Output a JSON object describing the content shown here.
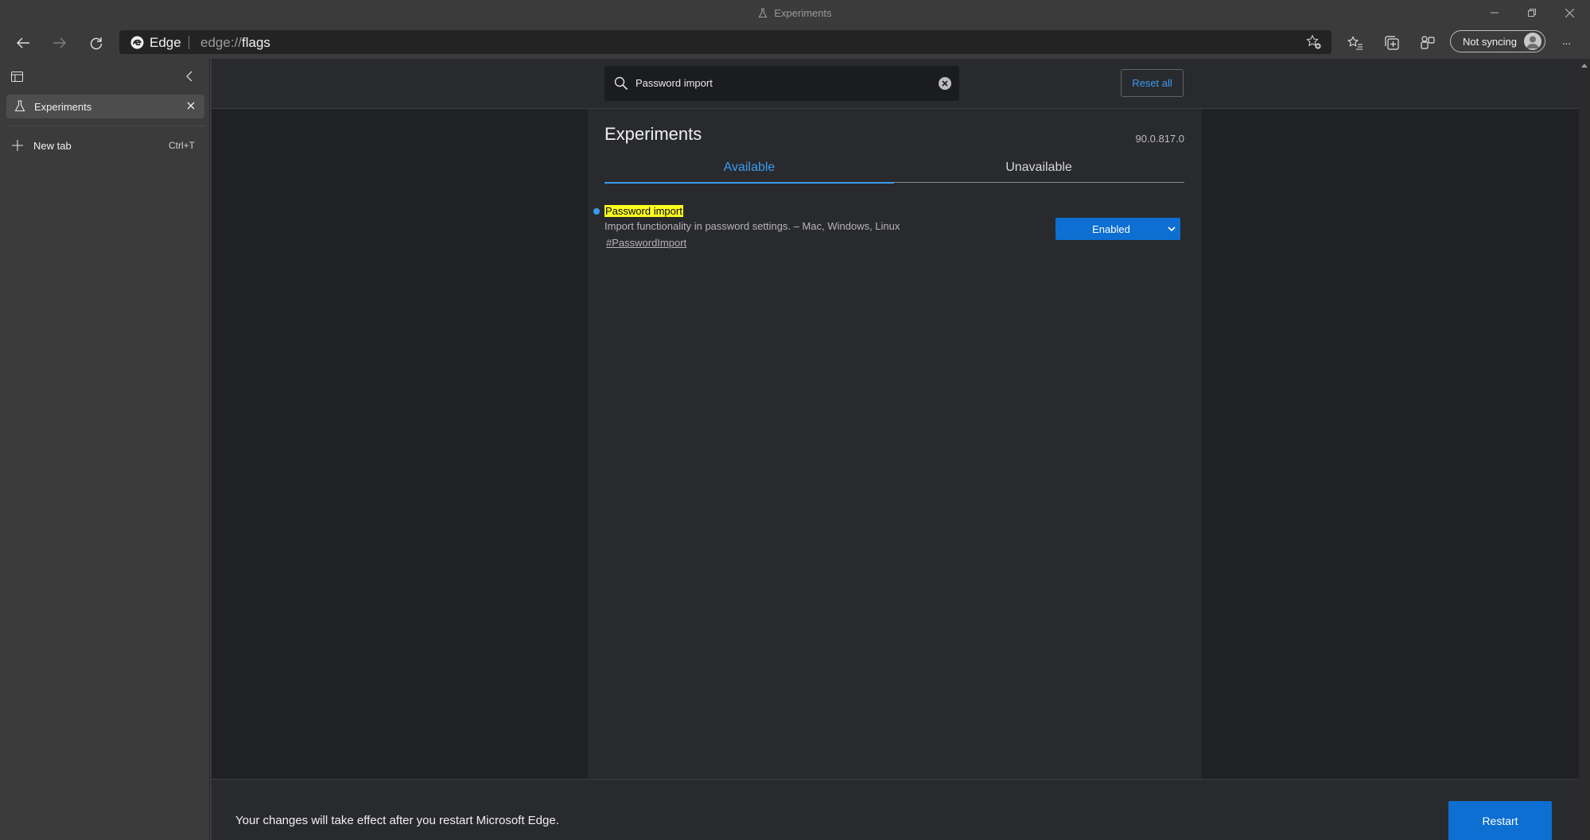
{
  "window": {
    "title": "Experiments",
    "controls": [
      "minimize-icon",
      "restore-icon",
      "close-icon"
    ]
  },
  "toolbar": {
    "back": "back-arrow-icon",
    "forward": "forward-arrow-icon",
    "refresh": "refresh-icon",
    "brand": "Edge",
    "url_scheme": "edge://",
    "url_host": "flags",
    "sync_label": "Not syncing",
    "more": "···"
  },
  "tabpane": {
    "tabs": [
      {
        "label": "Experiments",
        "active": true
      }
    ],
    "new_tab": {
      "label": "New tab",
      "shortcut": "Ctrl+T"
    }
  },
  "flags_page": {
    "search": {
      "query": "Password import"
    },
    "reset_all": "Reset all",
    "title": "Experiments",
    "version": "90.0.817.0",
    "tabs": [
      {
        "label": "Available",
        "selected": true
      },
      {
        "label": "Unavailable",
        "selected": false
      }
    ],
    "flag": {
      "name": "Password import",
      "description": "Import functionality in password settings. – Mac, Windows, Linux",
      "link": "#PasswordImport",
      "selected_value": "Enabled"
    },
    "footer": {
      "message": "Your changes will take effect after you restart Microsoft Edge.",
      "restart": "Restart"
    }
  },
  "colors": {
    "accent": "#3c9bf0",
    "button_blue": "#0d6fd1",
    "highlight": "#ffff1e",
    "page_bg": "#202124",
    "panel_bg": "#292a2d",
    "chrome_bg": "#3b3b3b"
  }
}
